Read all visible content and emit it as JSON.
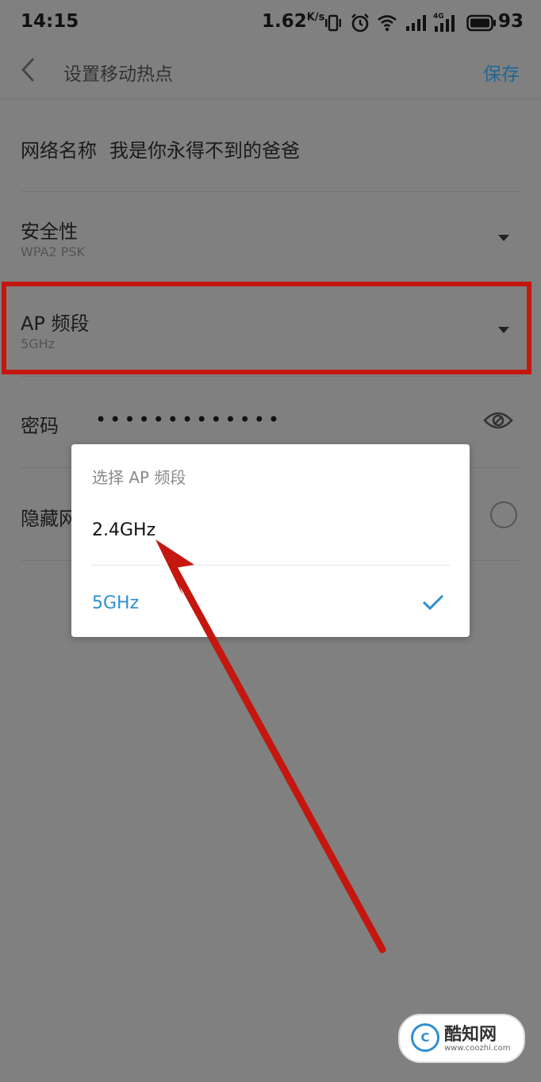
{
  "status_bar": {
    "time": "14:15",
    "net_speed": "1.62",
    "net_speed_unit": "K/s",
    "battery": "93"
  },
  "header": {
    "title": "设置移动热点",
    "save_label": "保存"
  },
  "settings": {
    "network_name_label": "网络名称",
    "network_name_value": "我是你永得不到的爸爸",
    "security_label": "安全性",
    "security_value": "WPA2 PSK",
    "ap_band_label": "AP 频段",
    "ap_band_value": "5GHz",
    "password_label": "密码",
    "password_value": "•••••••••••••",
    "hidden_label": "隐藏网"
  },
  "dialog": {
    "title": "选择 AP 频段",
    "options": [
      {
        "label": "2.4GHz",
        "selected": false
      },
      {
        "label": "5GHz",
        "selected": true
      }
    ]
  },
  "annotations": {
    "highlight_color": "#c4170f",
    "arrow_color": "#c4170f"
  },
  "watermark": {
    "logo_letter": "C",
    "name": "酷知网",
    "url": "www.coozhi.com"
  }
}
